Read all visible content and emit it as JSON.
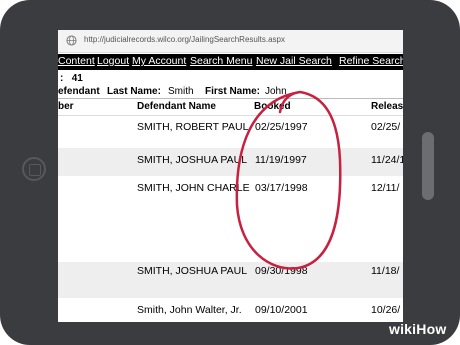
{
  "browser": {
    "url": "http://judicialrecords.wilco.org/JailingSearchResults.aspx"
  },
  "menu": {
    "items": [
      "Content",
      "Logout",
      "My Account",
      "Search Menu",
      "New Jail Search",
      "Refine Search"
    ]
  },
  "info": {
    "count_label": ":",
    "count_value": "41",
    "criteria_label": "efendant",
    "last_name_label": "Last Name:",
    "last_name_value": "Smith",
    "first_name_label": "First Name:",
    "first_name_value": "John"
  },
  "table": {
    "headers": [
      "ber",
      "Defendant Name",
      "Booked",
      "Releas"
    ],
    "rows": [
      {
        "name": "SMITH, ROBERT PAUL",
        "booked": "02/25/1997",
        "release": "02/25/"
      },
      {
        "name": "SMITH, JOSHUA PAUL",
        "booked": "11/19/1997",
        "release": "11/24/1"
      },
      {
        "name": "SMITH, JOHN CHARLE",
        "booked": "03/17/1998",
        "release": "12/11/"
      },
      {
        "name": "SMITH, JOSHUA PAUL",
        "booked": "09/30/1998",
        "release": "11/18/"
      },
      {
        "name": "Smith, John Walter, Jr.",
        "booked": "09/10/2001",
        "release": "10/26/"
      }
    ]
  },
  "watermark": {
    "brand": "wiki",
    "suffix": "How"
  },
  "colors": {
    "bezel": "#3b3c3f",
    "menu_bg": "#000000",
    "annotation": "#c8203f"
  }
}
